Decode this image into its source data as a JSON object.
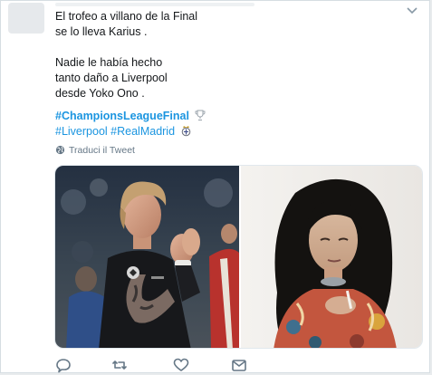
{
  "tweet": {
    "lines": [
      "El trofeo a villano de la Final",
      "se lo lleva Karius .",
      "",
      "Nadie le había hecho",
      "tanto daño a Liverpool",
      "desde Yoko Ono ."
    ],
    "hashtag_main": "#ChampionsLeagueFinal",
    "hashtag_liverpool": "#Liverpool",
    "hashtag_realmadrid": "#RealMadrid",
    "translate_label": "Traduci il Tweet"
  },
  "icons": {
    "trophy": "trophy-icon",
    "crest": "real-madrid-crest-icon",
    "globe": "globe-icon",
    "reply": "reply-icon",
    "retweet": "retweet-icon",
    "like": "like-icon",
    "message": "direct-message-icon",
    "chevron": "chevron-down-icon"
  },
  "colors": {
    "text": "#14171a",
    "link": "#1b95e0",
    "muted": "#657786"
  }
}
